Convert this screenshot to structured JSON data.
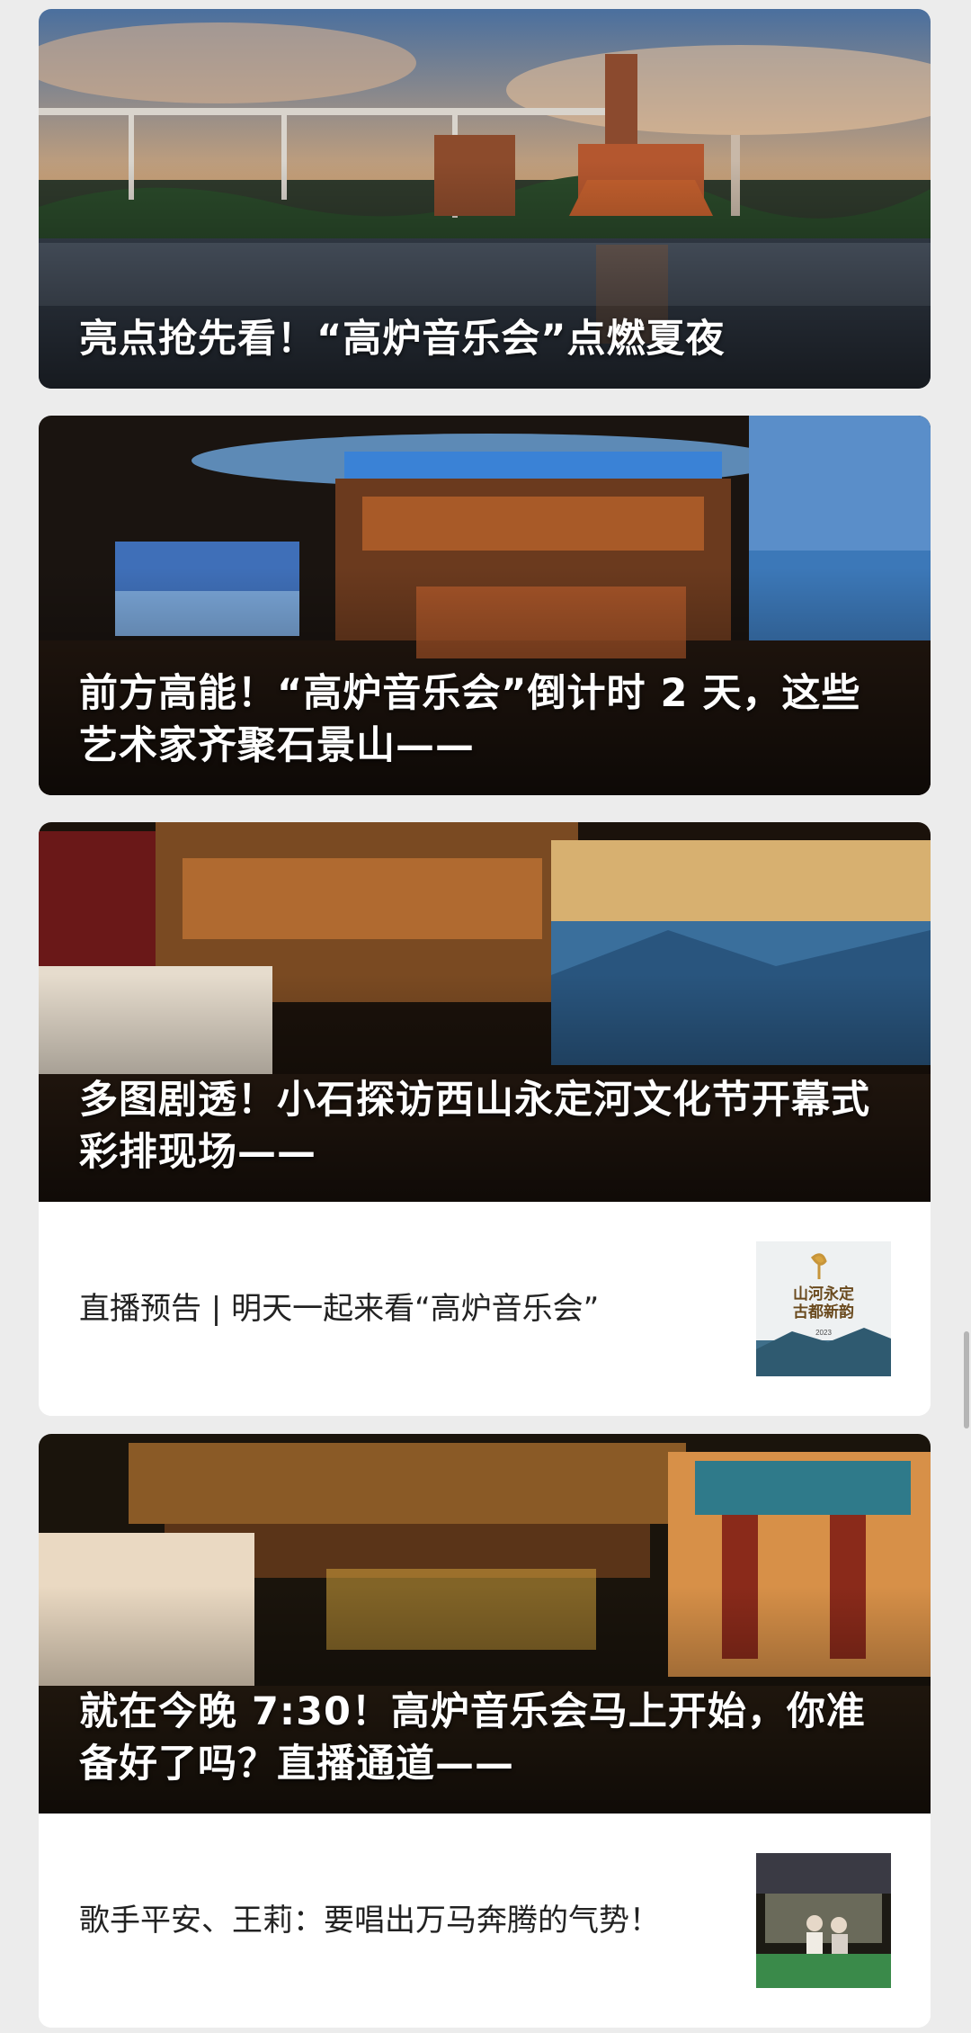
{
  "articles": [
    {
      "title": "亮点抢先看！“高炉音乐会”点燃夏夜"
    },
    {
      "title": "前方高能！“高炉音乐会”倒计时 2 天，这些艺术家齐聚石景山——"
    },
    {
      "title": "多图剧透！小石探访西山永定河文化节开幕式彩排现场——"
    },
    {
      "title": "直播预告 | 明天一起来看“高炉音乐会”",
      "thumb_text": [
        "山河永定",
        "古都新韵",
        "2023"
      ]
    },
    {
      "title": "就在今晚 7:30！高炉音乐会马上开始，你准备好了吗？直播通道——"
    },
    {
      "title": "歌手平安、王莉：要唱出万马奔腾的气势！"
    }
  ]
}
